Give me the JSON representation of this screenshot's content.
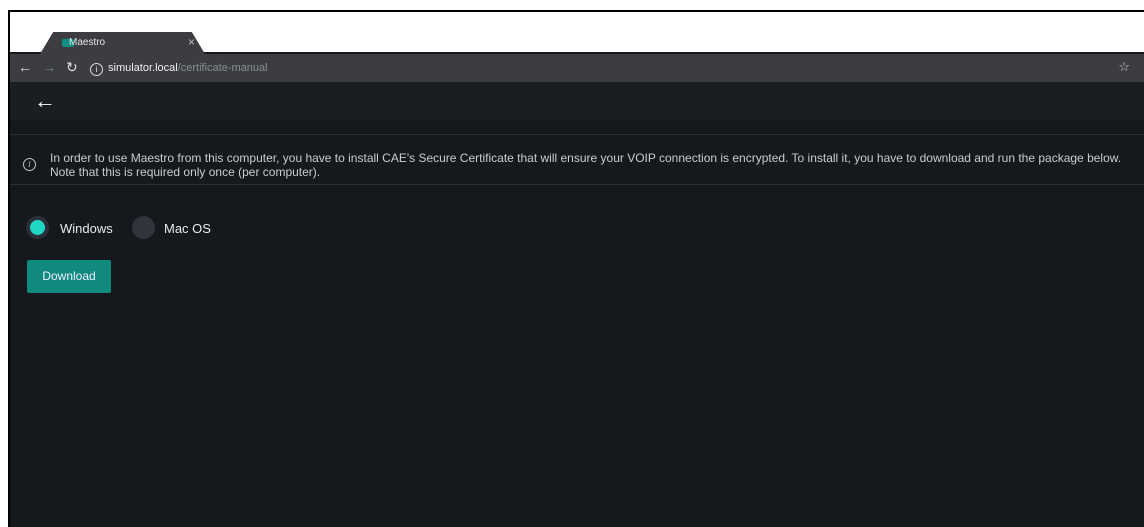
{
  "browser": {
    "tab_title": "Maestro",
    "tab_close": "×",
    "url_host": "simulator.local",
    "url_path": "/certificate-manual"
  },
  "icons": {
    "back": "back-arrow-icon",
    "info": "info-icon",
    "star": "star-icon",
    "reload": "reload-icon"
  },
  "notice": {
    "text": "In order to use Maestro from this computer, you have to install CAE's Secure Certificate that will ensure your VOIP connection is encrypted. To install it, you have to download and run the package below. Note that this is required only once (per computer)."
  },
  "os_options": [
    {
      "label": "Windows",
      "selected": true
    },
    {
      "label": "Mac OS",
      "selected": false
    }
  ],
  "actions": {
    "download_label": "Download"
  },
  "colors": {
    "accent": "#20d7c4",
    "button": "#118a7e",
    "background": "#15181d"
  }
}
